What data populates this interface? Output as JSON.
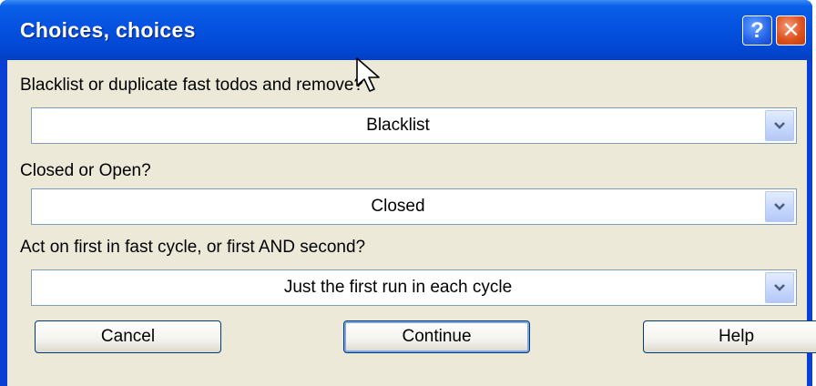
{
  "window": {
    "title": "Choices, choices",
    "help_glyph": "?",
    "close_glyph": "✕"
  },
  "fields": [
    {
      "label": "Blacklist or duplicate fast todos and remove?",
      "value": "Blacklist"
    },
    {
      "label": "Closed or Open?",
      "value": "Closed"
    },
    {
      "label": "Act on first in fast cycle, or first AND second?",
      "value": "Just the first run in each cycle"
    }
  ],
  "buttons": {
    "cancel": "Cancel",
    "continue": "Continue",
    "help": "Help"
  },
  "icons": {
    "dropdown": "chevron-down-icon",
    "cursor": "mouse-pointer-icon"
  }
}
